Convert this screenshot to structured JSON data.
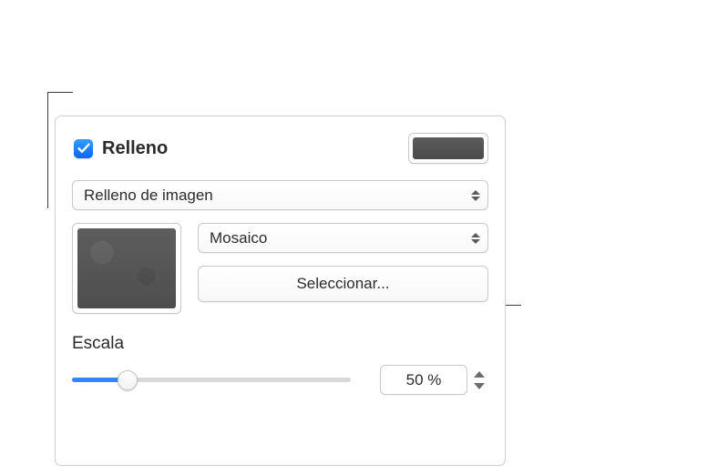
{
  "fill": {
    "section_label": "Relleno",
    "enabled": true,
    "color_hex": "#545454",
    "type_label": "Relleno de imagen",
    "tiling_label": "Mosaico",
    "choose_button_label": "Seleccionar...",
    "scale": {
      "label": "Escala",
      "value_text": "50 %",
      "value_percent": 50,
      "slider_fraction": 0.2
    }
  }
}
